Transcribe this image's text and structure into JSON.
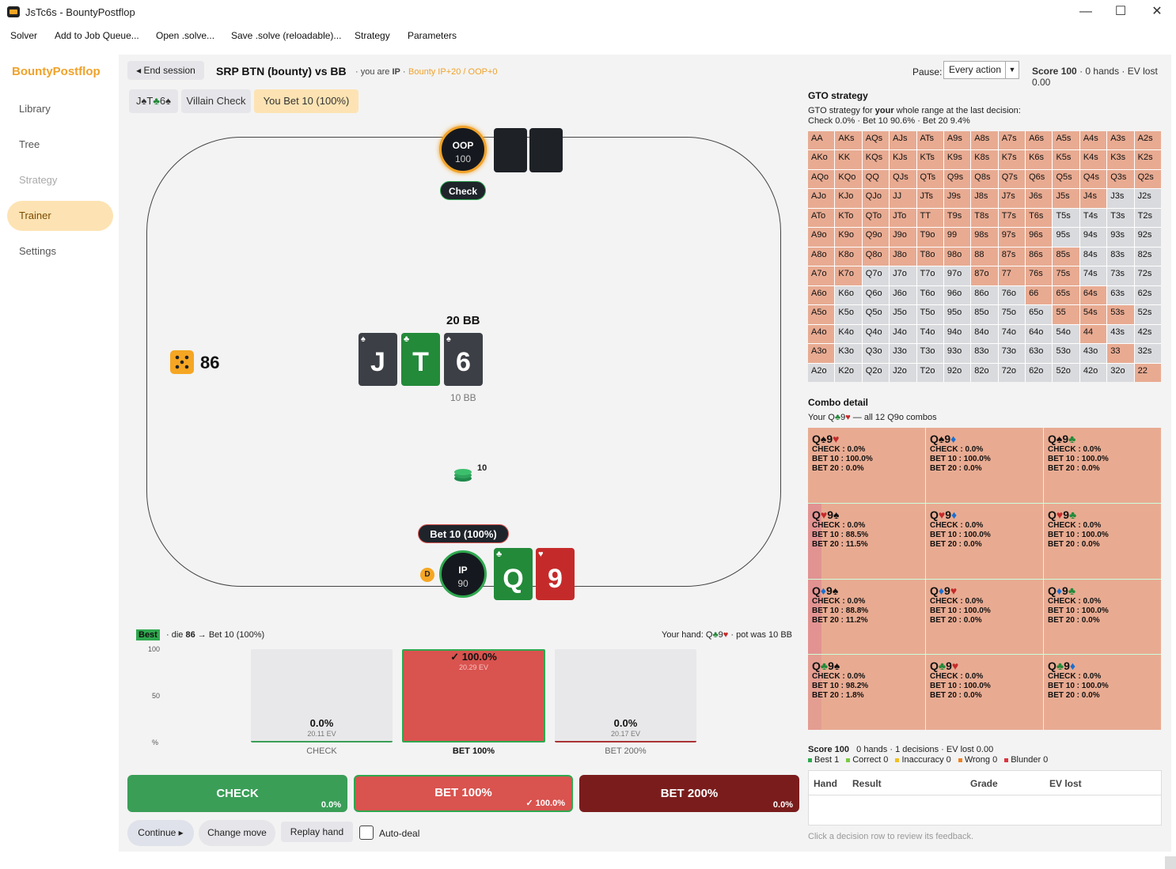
{
  "window": {
    "title": "JsTc6s - BountyPostflop",
    "minimize": "—",
    "maximize": "☐",
    "close": "✕"
  },
  "menu": [
    "Solver",
    "Add to Job Queue...",
    "Open .solve...",
    "Save .solve (reloadable)...",
    "Strategy",
    "Parameters"
  ],
  "sidebar": {
    "brand": "BountyPostflop",
    "items": [
      "Library",
      "Tree",
      "Strategy",
      "Trainer",
      "Settings"
    ]
  },
  "session": {
    "end_label": "◂ End session",
    "title": "SRP BTN (bounty) vs BB",
    "you_are_prefix": "· you are ",
    "you_are_role": "IP",
    "you_are_suffix": " ·",
    "bounty": "Bounty IP+20 / OOP+0"
  },
  "history_chips": {
    "board_j": "J",
    "board_j_suit": "♠",
    "board_t": "T",
    "board_t_suit": "♣",
    "board_6": "6",
    "board_6_suit": "♠",
    "villain": "Villain Check",
    "you": "You Bet 10 (100%)"
  },
  "pause": {
    "label": "Pause:",
    "value": "Every action",
    "arrow": "▼"
  },
  "score_top": {
    "label": "Score",
    "value": "100",
    "rest": " · 0 hands · EV lost 0.00"
  },
  "table": {
    "oop": {
      "name": "OOP",
      "stack": "100",
      "action": "Check"
    },
    "ip": {
      "name": "IP",
      "stack": "90",
      "action": "Bet 10 (100%)",
      "dealer": "D"
    },
    "pot": "20 BB",
    "pot_sub": "10 BB",
    "die": "86",
    "bet_chips": "10",
    "board": [
      {
        "rank": "J",
        "suit": "♠",
        "color": "#3c3f46"
      },
      {
        "rank": "T",
        "suit": "♣",
        "color": "#238a3a"
      },
      {
        "rank": "6",
        "suit": "♠",
        "color": "#3c3f46"
      }
    ],
    "hero": [
      {
        "rank": "Q",
        "suit": "♣",
        "color": "#238a3a"
      },
      {
        "rank": "9",
        "suit": "♥",
        "color": "#c52a2a"
      }
    ]
  },
  "feedback": {
    "badge": "Best",
    "text_pre": "· die ",
    "die": "86",
    "text_post": " → Bet 10 (100%)",
    "hand_label": "Your hand: ",
    "hand_q": "Q",
    "hand_q_suit": "♣",
    "hand_9": "9",
    "hand_9_suit": "♥",
    "hand_post": " · pot was 10 BB",
    "y_ticks": [
      "100",
      "50",
      "%"
    ]
  },
  "ev_bars": [
    {
      "label": "CHECK",
      "pct": "0.0%",
      "ev": "20.11 EV",
      "freq": 0.0
    },
    {
      "label": "BET 100%",
      "pct": "✓ 100.0%",
      "ev": "20.29 EV",
      "freq": 1.0
    },
    {
      "label": "BET 200%",
      "pct": "0.0%",
      "ev": "20.17 EV",
      "freq": 0.0
    }
  ],
  "actions": [
    {
      "label": "CHECK",
      "pct": "0.0%",
      "color": "#3a9e57"
    },
    {
      "label": "BET 100%",
      "pct": "✓ 100.0%",
      "color": "#d9534f"
    },
    {
      "label": "BET 200%",
      "pct": "0.0%",
      "color": "#7a1c1c"
    }
  ],
  "bottom_buttons": {
    "continue": "Continue ▸",
    "change": "Change move",
    "replay": "Replay hand",
    "autodeal": "Auto-deal"
  },
  "gto": {
    "header": "GTO strategy",
    "desc_pre": "GTO strategy for ",
    "desc_bold": "your",
    "desc_post": " whole range at the last decision:",
    "freqs": "Check 0.0% · Bet 10 90.6% · Bet 20 9.4%",
    "grid": [
      [
        "AA",
        "AKs",
        "AQs",
        "AJs",
        "ATs",
        "A9s",
        "A8s",
        "A7s",
        "A6s",
        "A5s",
        "A4s",
        "A3s",
        "A2s"
      ],
      [
        "AKo",
        "KK",
        "KQs",
        "KJs",
        "KTs",
        "K9s",
        "K8s",
        "K7s",
        "K6s",
        "K5s",
        "K4s",
        "K3s",
        "K2s"
      ],
      [
        "AQo",
        "KQo",
        "QQ",
        "QJs",
        "QTs",
        "Q9s",
        "Q8s",
        "Q7s",
        "Q6s",
        "Q5s",
        "Q4s",
        "Q3s",
        "Q2s"
      ],
      [
        "AJo",
        "KJo",
        "QJo",
        "JJ",
        "JTs",
        "J9s",
        "J8s",
        "J7s",
        "J6s",
        "J5s",
        "J4s",
        "J3s",
        "J2s"
      ],
      [
        "ATo",
        "KTo",
        "QTo",
        "JTo",
        "TT",
        "T9s",
        "T8s",
        "T7s",
        "T6s",
        "T5s",
        "T4s",
        "T3s",
        "T2s"
      ],
      [
        "A9o",
        "K9o",
        "Q9o",
        "J9o",
        "T9o",
        "99",
        "98s",
        "97s",
        "96s",
        "95s",
        "94s",
        "93s",
        "92s"
      ],
      [
        "A8o",
        "K8o",
        "Q8o",
        "J8o",
        "T8o",
        "98o",
        "88",
        "87s",
        "86s",
        "85s",
        "84s",
        "83s",
        "82s"
      ],
      [
        "A7o",
        "K7o",
        "Q7o",
        "J7o",
        "T7o",
        "97o",
        "87o",
        "77",
        "76s",
        "75s",
        "74s",
        "73s",
        "72s"
      ],
      [
        "A6o",
        "K6o",
        "Q6o",
        "J6o",
        "T6o",
        "96o",
        "86o",
        "76o",
        "66",
        "65s",
        "64s",
        "63s",
        "62s"
      ],
      [
        "A5o",
        "K5o",
        "Q5o",
        "J5o",
        "T5o",
        "95o",
        "85o",
        "75o",
        "65o",
        "55",
        "54s",
        "53s",
        "52s"
      ],
      [
        "A4o",
        "K4o",
        "Q4o",
        "J4o",
        "T4o",
        "94o",
        "84o",
        "74o",
        "64o",
        "54o",
        "44",
        "43s",
        "42s"
      ],
      [
        "A3o",
        "K3o",
        "Q3o",
        "J3o",
        "T3o",
        "93o",
        "83o",
        "73o",
        "63o",
        "53o",
        "43o",
        "33",
        "32s"
      ],
      [
        "A2o",
        "K2o",
        "Q2o",
        "J2o",
        "T2o",
        "92o",
        "82o",
        "72o",
        "62o",
        "52o",
        "42o",
        "32o",
        "22"
      ]
    ],
    "in_range": [
      [
        1,
        1,
        1,
        1,
        1,
        1,
        1,
        1,
        1,
        1,
        1,
        1,
        1
      ],
      [
        1,
        1,
        1,
        1,
        1,
        1,
        1,
        1,
        1,
        1,
        1,
        1,
        1
      ],
      [
        1,
        1,
        1,
        1,
        1,
        1,
        1,
        1,
        1,
        1,
        1,
        1,
        1
      ],
      [
        1,
        1,
        1,
        1,
        1,
        1,
        1,
        1,
        1,
        1,
        1,
        0,
        0
      ],
      [
        1,
        1,
        1,
        1,
        1,
        1,
        1,
        1,
        1,
        0,
        0,
        0,
        0
      ],
      [
        1,
        1,
        1,
        1,
        1,
        1,
        1,
        1,
        1,
        0,
        0,
        0,
        0
      ],
      [
        1,
        1,
        1,
        1,
        1,
        1,
        1,
        1,
        1,
        1,
        0,
        0,
        0
      ],
      [
        1,
        1,
        0,
        0,
        0,
        0,
        1,
        1,
        1,
        1,
        0,
        0,
        0
      ],
      [
        1,
        0,
        0,
        0,
        0,
        0,
        0,
        0,
        1,
        1,
        1,
        0,
        0
      ],
      [
        1,
        0,
        0,
        0,
        0,
        0,
        0,
        0,
        0,
        1,
        1,
        1,
        0
      ],
      [
        1,
        0,
        0,
        0,
        0,
        0,
        0,
        0,
        0,
        0,
        1,
        0,
        0
      ],
      [
        1,
        0,
        0,
        0,
        0,
        0,
        0,
        0,
        0,
        0,
        0,
        1,
        0
      ],
      [
        0,
        0,
        0,
        0,
        0,
        0,
        0,
        0,
        0,
        0,
        0,
        0,
        1
      ]
    ]
  },
  "combo": {
    "header": "Combo detail",
    "desc_pre": "Your ",
    "desc_q": "Q",
    "desc_q_suit": "♣",
    "desc_9": "9",
    "desc_9_suit": "♥",
    "desc_post": " — all 12 Q9o combos",
    "cells": [
      {
        "q": "♠",
        "n": "♥",
        "check": "CHECK : 0.0%",
        "bet10": "BET 10 : 100.0%",
        "bet20": "BET 20 : 0.0%",
        "bet20_freq": 0.0
      },
      {
        "q": "♠",
        "n": "♦",
        "check": "CHECK : 0.0%",
        "bet10": "BET 10 : 100.0%",
        "bet20": "BET 20 : 0.0%",
        "bet20_freq": 0.0
      },
      {
        "q": "♠",
        "n": "♣",
        "check": "CHECK : 0.0%",
        "bet10": "BET 10 : 100.0%",
        "bet20": "BET 20 : 0.0%",
        "bet20_freq": 0.0
      },
      {
        "q": "♥",
        "n": "♠",
        "check": "CHECK : 0.0%",
        "bet10": "BET 10 : 88.5%",
        "bet20": "BET 20 : 11.5%",
        "bet20_freq": 0.115
      },
      {
        "q": "♥",
        "n": "♦",
        "check": "CHECK : 0.0%",
        "bet10": "BET 10 : 100.0%",
        "bet20": "BET 20 : 0.0%",
        "bet20_freq": 0.0
      },
      {
        "q": "♥",
        "n": "♣",
        "check": "CHECK : 0.0%",
        "bet10": "BET 10 : 100.0%",
        "bet20": "BET 20 : 0.0%",
        "bet20_freq": 0.0
      },
      {
        "q": "♦",
        "n": "♠",
        "check": "CHECK : 0.0%",
        "bet10": "BET 10 : 88.8%",
        "bet20": "BET 20 : 11.2%",
        "bet20_freq": 0.112
      },
      {
        "q": "♦",
        "n": "♥",
        "check": "CHECK : 0.0%",
        "bet10": "BET 10 : 100.0%",
        "bet20": "BET 20 : 0.0%",
        "bet20_freq": 0.0
      },
      {
        "q": "♦",
        "n": "♣",
        "check": "CHECK : 0.0%",
        "bet10": "BET 10 : 100.0%",
        "bet20": "BET 20 : 0.0%",
        "bet20_freq": 0.0
      },
      {
        "q": "♣",
        "n": "♠",
        "check": "CHECK : 0.0%",
        "bet10": "BET 10 : 98.2%",
        "bet20": "BET 20 : 1.8%",
        "bet20_freq": 0.018
      },
      {
        "q": "♣",
        "n": "♥",
        "check": "CHECK : 0.0%",
        "bet10": "BET 10 : 100.0%",
        "bet20": "BET 20 : 0.0%",
        "bet20_freq": 0.0
      },
      {
        "q": "♣",
        "n": "♦",
        "check": "CHECK : 0.0%",
        "bet10": "BET 10 : 100.0%",
        "bet20": "BET 20 : 0.0%",
        "bet20_freq": 0.0
      }
    ]
  },
  "score_panel": {
    "title": "Score 100",
    "summary": "0 hands · 1 decisions · EV lost 0.00",
    "legend": [
      {
        "label": "Best 1",
        "color": "#2fa84f"
      },
      {
        "label": "Correct 0",
        "color": "#7ac943"
      },
      {
        "label": "Inaccuracy 0",
        "color": "#f0c020"
      },
      {
        "label": "Wrong 0",
        "color": "#f08020"
      },
      {
        "label": "Blunder 0",
        "color": "#d9363e"
      }
    ],
    "columns": [
      "Hand",
      "Result",
      "Grade",
      "EV lost"
    ],
    "hint": "Click a decision row to review its feedback."
  }
}
